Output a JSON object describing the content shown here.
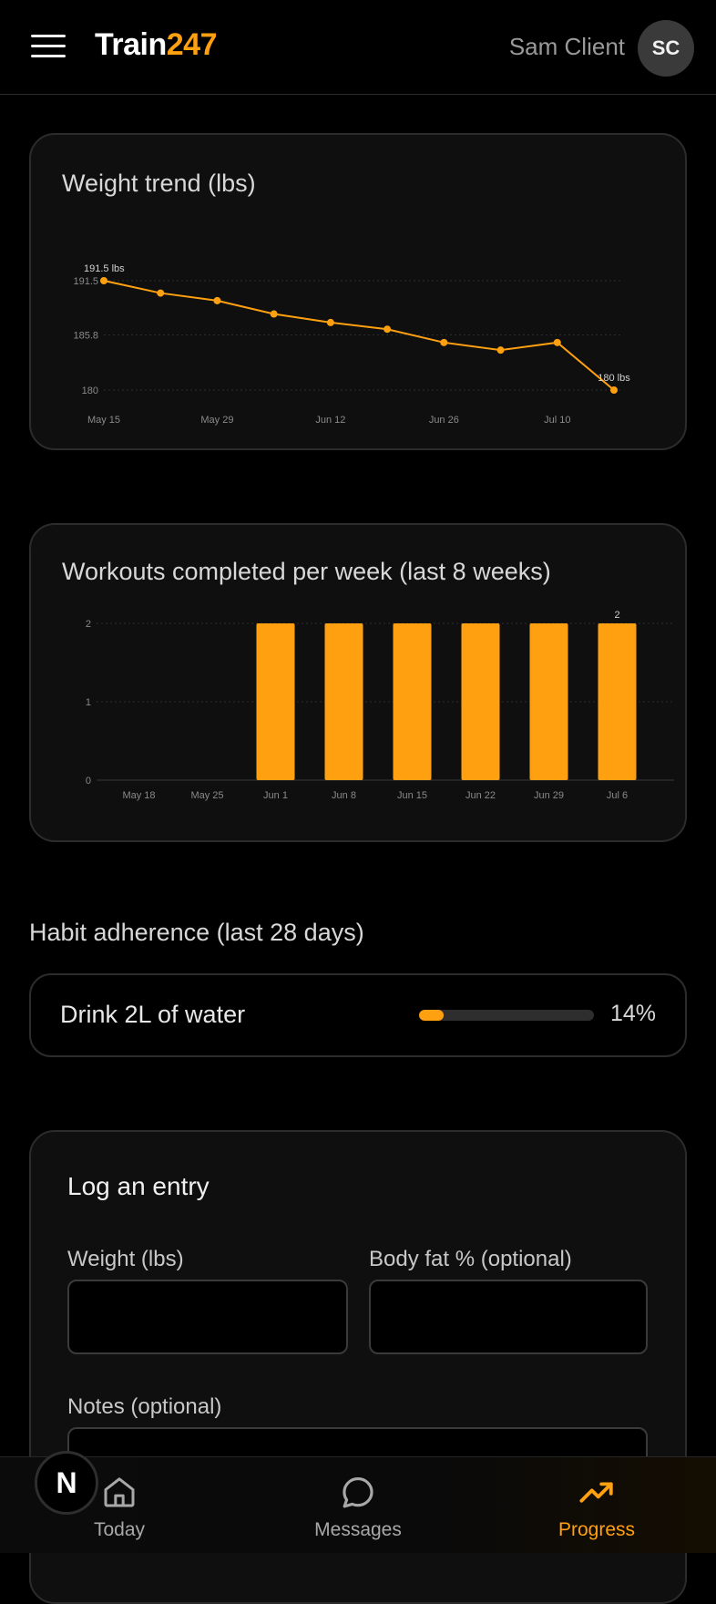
{
  "header": {
    "brand_main": "Train",
    "brand_accent": "247",
    "user_name": "Sam Client",
    "user_initials": "SC"
  },
  "weight_card": {
    "title": "Weight trend (lbs)"
  },
  "workouts_card": {
    "title": "Workouts completed per week (last 8 weeks)"
  },
  "chart_data": [
    {
      "type": "line",
      "title": "Weight trend (lbs)",
      "x": [
        "May 15",
        "May 22",
        "May 29",
        "Jun 5",
        "Jun 12",
        "Jun 19",
        "Jun 26",
        "Jul 3",
        "Jul 10",
        "Jul 17"
      ],
      "x_tick_labels": [
        "May 15",
        "May 29",
        "Jun 12",
        "Jun 26",
        "Jul 10"
      ],
      "y_tick_labels": [
        "191.5",
        "185.8",
        "180"
      ],
      "series": [
        {
          "values": [
            191.5,
            190.2,
            189.4,
            188.0,
            187.1,
            186.4,
            185.0,
            184.2,
            185.0,
            180.0
          ]
        }
      ],
      "point_labels": [
        {
          "index": 0,
          "text": "191.5 lbs"
        },
        {
          "index": 9,
          "text": "180 lbs"
        }
      ],
      "ylim": [
        180,
        191.5
      ],
      "grid": true,
      "color": "#ffa010"
    },
    {
      "type": "bar",
      "title": "Workouts completed per week (last 8 weeks)",
      "categories": [
        "May 18",
        "May 25",
        "Jun 1",
        "Jun 8",
        "Jun 15",
        "Jun 22",
        "Jun 29",
        "Jul 6"
      ],
      "values": [
        0,
        0,
        2,
        2,
        2,
        2,
        2,
        2
      ],
      "y_tick_labels": [
        "2",
        "1",
        "0"
      ],
      "value_labels": [
        {
          "index": 7,
          "text": "2"
        }
      ],
      "ylim": [
        0,
        2
      ],
      "grid": true,
      "color": "#ffa010"
    }
  ],
  "habits": {
    "title": "Habit adherence (last 28 days)",
    "items": [
      {
        "name": "Drink 2L of water",
        "percent_text": "14%",
        "percent": 14
      }
    ]
  },
  "log_entry": {
    "title": "Log an entry",
    "weight_label": "Weight (lbs)",
    "weight_value": "",
    "bodyfat_label": "Body fat % (optional)",
    "bodyfat_value": "",
    "notes_label": "Notes (optional)",
    "notes_value": ""
  },
  "bottom_nav": {
    "badge_letter": "N",
    "items": [
      {
        "label": "Today",
        "icon": "home-icon",
        "active": false
      },
      {
        "label": "Messages",
        "icon": "chat-bubble-icon",
        "active": false
      },
      {
        "label": "Progress",
        "icon": "trending-up-icon",
        "active": true
      }
    ]
  },
  "colors": {
    "accent": "#ffa010",
    "background": "#000000",
    "card": "#0f0f0f"
  }
}
